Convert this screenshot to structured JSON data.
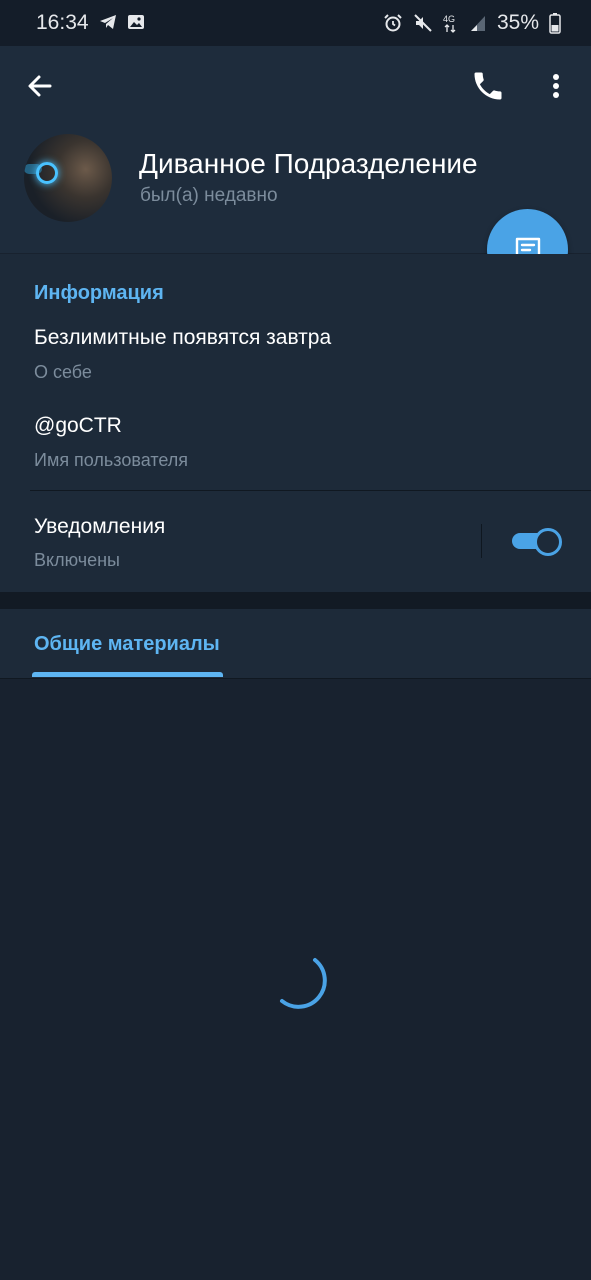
{
  "status_bar": {
    "time": "16:34",
    "battery_percent": "35%"
  },
  "header": {
    "name": "Диванное Подразделение",
    "status": "был(а) недавно"
  },
  "info": {
    "section_title": "Информация",
    "bio": "Безлимитные появятся завтра",
    "bio_label": "О себе",
    "username": "@goCTR",
    "username_label": "Имя пользователя",
    "notifications": "Уведомления",
    "notifications_state": "Включены",
    "notifications_enabled": true
  },
  "tabs": {
    "shared_media": "Общие материалы"
  },
  "colors": {
    "accent": "#5eb5f2",
    "fab": "#4aa3e6",
    "background": "#18222f",
    "header_bg": "#1e2c3c"
  },
  "icons": [
    "telegram-icon",
    "gallery-icon",
    "alarm-icon",
    "mute-icon",
    "network-4g-icon",
    "signal-icon",
    "battery-icon",
    "back-arrow-icon",
    "phone-icon",
    "more-vertical-icon",
    "message-icon",
    "loading-spinner-icon"
  ]
}
